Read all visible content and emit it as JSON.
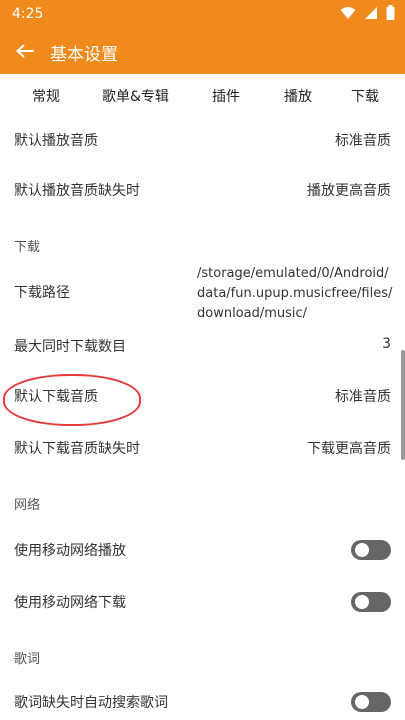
{
  "status": {
    "time": "4:25"
  },
  "app": {
    "title": "基本设置"
  },
  "tabs": [
    "常规",
    "歌单&专辑",
    "插件",
    "播放",
    "下载"
  ],
  "settings": {
    "default_play_quality": {
      "label": "默认播放音质",
      "value": "标准音质"
    },
    "play_quality_missing": {
      "label": "默认播放音质缺失时",
      "value": "播放更高音质"
    },
    "section_download": "下载",
    "download_path": {
      "label": "下载路径",
      "value": "/storage/emulated/0/Android/data/fun.upup.musicfree/files/download/music/"
    },
    "max_downloads": {
      "label": "最大同时下载数目",
      "value": "3"
    },
    "default_download_quality": {
      "label": "默认下载音质",
      "value": "标准音质"
    },
    "download_quality_missing": {
      "label": "默认下载音质缺失时",
      "value": "下载更高音质"
    },
    "section_network": "网络",
    "mobile_play": {
      "label": "使用移动网络播放"
    },
    "mobile_download": {
      "label": "使用移动网络下载"
    },
    "section_lyrics": "歌词",
    "lyrics_auto_search": {
      "label": "歌词缺失时自动搜索歌词"
    }
  },
  "colors": {
    "accent": "#f08a1c",
    "highlight": "#e23b3b"
  }
}
